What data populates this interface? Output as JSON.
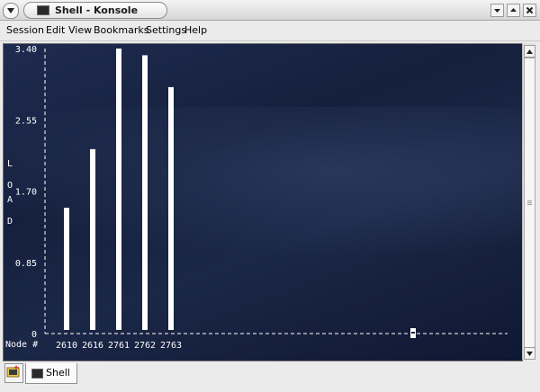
{
  "window": {
    "title": "Shell - Konsole"
  },
  "menubar": {
    "items": [
      "Session",
      "Edit",
      "View",
      "Bookmarks",
      "Settings",
      "Help"
    ]
  },
  "chart_data": {
    "type": "bar",
    "title": "",
    "xlabel": "Node #",
    "ylabel": "LOAD",
    "categories": [
      "2610",
      "2616",
      "2761",
      "2762",
      "2763"
    ],
    "values": [
      1.5,
      2.2,
      3.4,
      3.32,
      2.94
    ],
    "yticks": [
      "3.40",
      "2.55",
      "1.70",
      "0.85",
      "0"
    ],
    "ylim": [
      0,
      3.4
    ],
    "bar_color": "#ffffff",
    "background": "#18233f"
  },
  "tabs": [
    {
      "label": "Shell",
      "active": true
    }
  ],
  "icons": {
    "window_menu": "chevron-down-icon",
    "title": "terminal-icon",
    "minimize": "minimize-icon",
    "maximize": "maximize-icon",
    "close": "close-icon",
    "new_session": "new-session-icon",
    "tab": "terminal-icon"
  }
}
